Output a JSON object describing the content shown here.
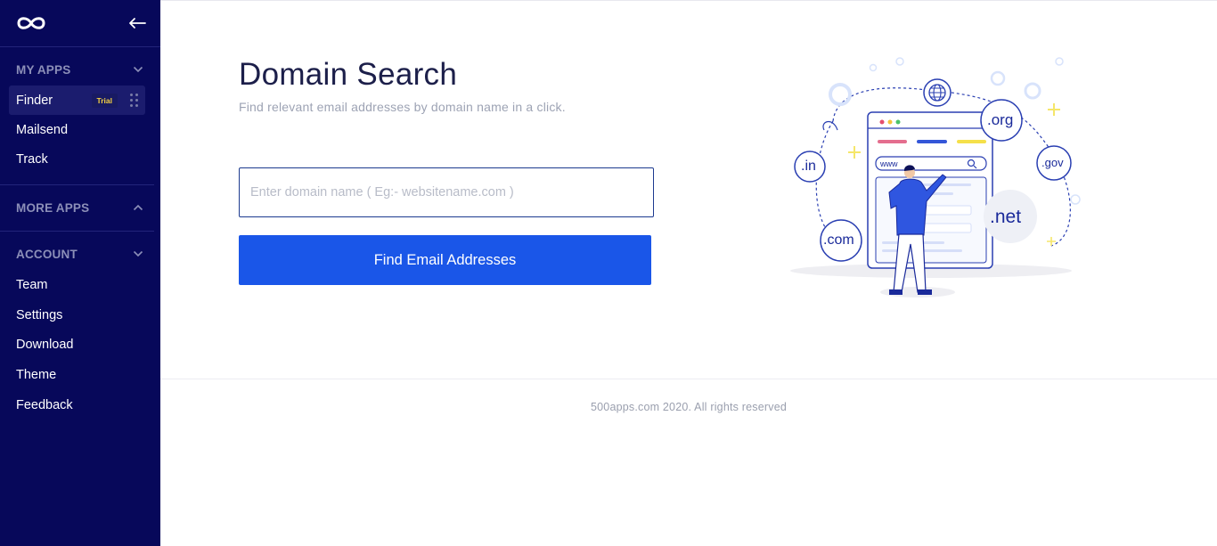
{
  "sidebar": {
    "logo_icon": "infinity-logo-icon",
    "collapse_icon": "arrow-left-icon",
    "sections": {
      "my_apps": {
        "title": "MY APPS",
        "expanded": true,
        "items": [
          {
            "label": "Finder",
            "badge": "Trial",
            "active": true
          },
          {
            "label": "Mailsend"
          },
          {
            "label": "Track"
          }
        ]
      },
      "more_apps": {
        "title": "MORE APPS",
        "expanded": false
      },
      "account": {
        "title": "ACCOUNT",
        "expanded": true,
        "items": [
          {
            "label": "Team"
          },
          {
            "label": "Settings"
          },
          {
            "label": "Download"
          },
          {
            "label": "Theme"
          },
          {
            "label": "Feedback"
          }
        ]
      }
    }
  },
  "main": {
    "title": "Domain Search",
    "subtitle": "Find relevant email addresses by domain name in a click.",
    "search": {
      "placeholder": "Enter domain name ( Eg:- websitename.com )",
      "value": ""
    },
    "button_label": "Find Email Addresses",
    "illustration": {
      "tlds": {
        "org": ".org",
        "in": ".in",
        "gov": ".gov",
        "net": ".net",
        "com": ".com"
      },
      "url_text": "www"
    }
  },
  "footer": {
    "text": "500apps.com 2020. All rights reserved"
  },
  "colors": {
    "sidebar_bg": "#07085a",
    "accent": "#1a56e8",
    "title": "#1c1f4a",
    "trial_text": "#f5d142"
  }
}
